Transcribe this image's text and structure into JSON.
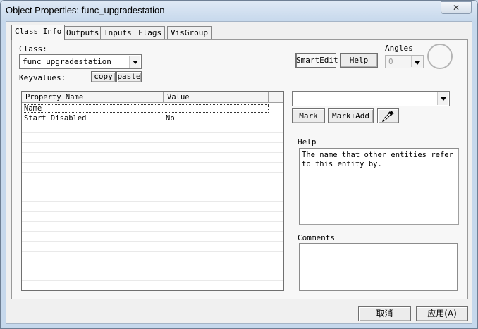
{
  "window": {
    "title": "Object Properties: func_upgradestation",
    "close_glyph": "✕"
  },
  "tabs": [
    {
      "label": "Class Info",
      "active": true
    },
    {
      "label": "Outputs",
      "active": false
    },
    {
      "label": "Inputs",
      "active": false
    },
    {
      "label": "Flags",
      "active": false
    },
    {
      "label": "VisGroup",
      "active": false
    }
  ],
  "class_section": {
    "label": "Class:",
    "value": "func_upgradestation"
  },
  "keyvalues": {
    "label": "Keyvalues:",
    "copy_label": "copy",
    "paste_label": "paste"
  },
  "smartedit_label": "SmartEdit",
  "help_button_label": "Help",
  "angles": {
    "label": "Angles",
    "value": "0"
  },
  "table": {
    "columns": [
      "Property Name",
      "Value"
    ],
    "rows": [
      {
        "name": "Name",
        "value": "",
        "selected": true
      },
      {
        "name": "Start Disabled",
        "value": "No",
        "selected": false
      }
    ]
  },
  "value_combo": {
    "value": ""
  },
  "mark_label": "Mark",
  "mark_add_label": "Mark+Add",
  "eyedropper_icon": "eyedropper-icon",
  "help_section": {
    "label": "Help",
    "text": "The name that other entities refer to this entity by."
  },
  "comments_section": {
    "label": "Comments",
    "text": ""
  },
  "footer": {
    "cancel_label": "取消",
    "apply_label": "应用(A)"
  },
  "colors": {
    "title_bar": "#c9d9ea",
    "panel": "#f7f7f7",
    "client": "#f0f0f0"
  }
}
